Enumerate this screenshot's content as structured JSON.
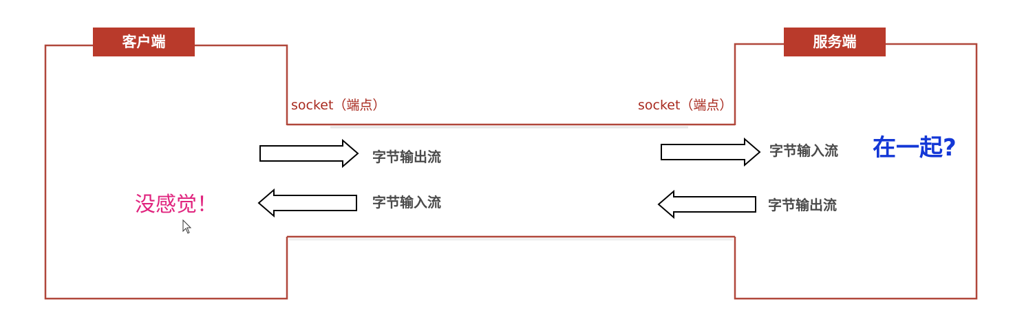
{
  "client": {
    "title": "客户端",
    "socket_label": "socket（端点）",
    "note": "没感觉！"
  },
  "server": {
    "title": "服务端",
    "socket_label": "socket（端点）",
    "note": "在一起?"
  },
  "streams": {
    "client_out": "字节输出流",
    "client_in": "字节输入流",
    "server_in": "字节输入流",
    "server_out": "字节输出流"
  },
  "colors": {
    "frame": "#b0473a",
    "label_bg": "#b93a2b",
    "socket_text": "#a8291e",
    "note_pink": "#e0247e",
    "note_blue": "#1337d6"
  }
}
